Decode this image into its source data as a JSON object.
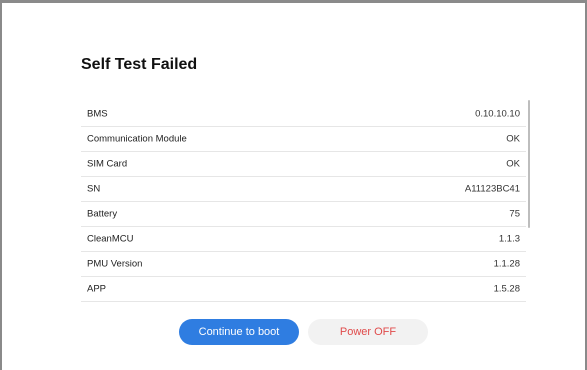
{
  "dialog": {
    "title": "Self Test Failed"
  },
  "items": [
    {
      "label": "BMS",
      "value": "0.10.10.10"
    },
    {
      "label": "Communication Module",
      "value": "OK"
    },
    {
      "label": "SIM Card",
      "value": "OK"
    },
    {
      "label": "SN",
      "value": "A11123BC41"
    },
    {
      "label": "Battery",
      "value": "75"
    },
    {
      "label": "CleanMCU",
      "value": "1.1.3"
    },
    {
      "label": "PMU Version",
      "value": "1.1.28"
    },
    {
      "label": "APP",
      "value": "1.5.28"
    }
  ],
  "actions": {
    "continue_label": "Continue to boot",
    "power_off_label": "Power OFF"
  },
  "colors": {
    "primary": "#2f7de1",
    "danger_text": "#e04b4b",
    "secondary_bg": "#f2f2f2"
  }
}
